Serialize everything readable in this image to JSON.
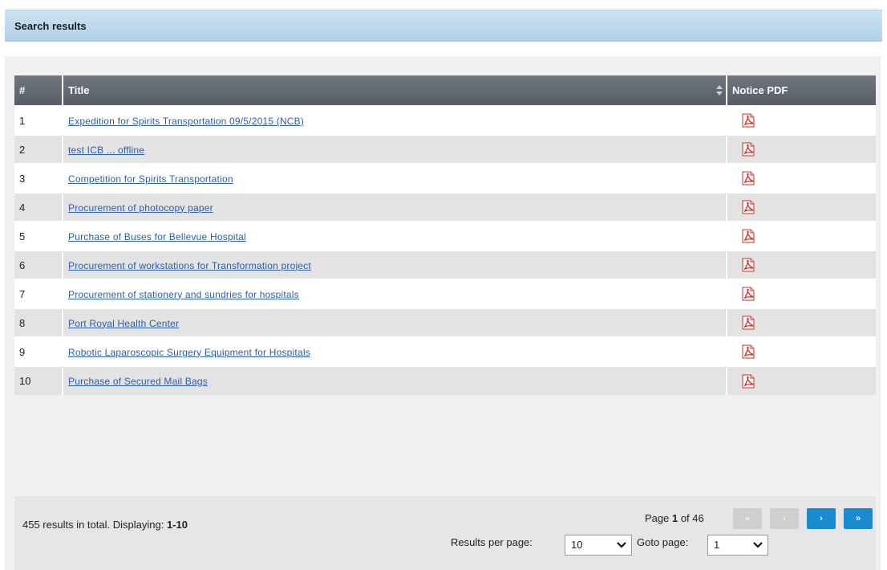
{
  "header": {
    "title": "Search results"
  },
  "table": {
    "columns": {
      "num": "#",
      "title": "Title",
      "pdf": "Notice PDF"
    },
    "rows": [
      {
        "num": "1",
        "title": "Expedition for Spirits Transportation 09/5/2015 (NCB)"
      },
      {
        "num": "2",
        "title": "test ICB ... offline"
      },
      {
        "num": "3",
        "title": "Competition for Spirits Transportation"
      },
      {
        "num": "4",
        "title": "Procurement of photocopy paper"
      },
      {
        "num": "5",
        "title": "Purchase of Buses for Bellevue Hospital"
      },
      {
        "num": "6",
        "title": "Procurement of workstations for Transformation project"
      },
      {
        "num": "7",
        "title": "Procurement of stationery and sundries for hospitals"
      },
      {
        "num": "8",
        "title": "Port Royal Health Center"
      },
      {
        "num": "9",
        "title": "Robotic Laparoscopic Surgery Equipment for Hospitals"
      },
      {
        "num": "10",
        "title": "Purchase of Secured Mail Bags"
      }
    ],
    "pdf_icon": "pdf-file-icon"
  },
  "footer": {
    "total_prefix": "455 results in total. Displaying: ",
    "total_range": "1-10",
    "page_prefix": "Page ",
    "page_current": "1",
    "page_suffix": " of 46",
    "buttons": {
      "first": "«",
      "prev": "‹",
      "next": "›",
      "last": "»"
    },
    "results_per_page_label": "Results per page:",
    "results_per_page_value": "10",
    "goto_label": "Goto page:",
    "goto_value": "1"
  },
  "colors": {
    "header_bg": "#aecfe6",
    "table_header_bg": "#5f666f",
    "row_alt_bg": "#e3e3e3",
    "link": "#2a5db0",
    "pager_active": "#1b8bd0",
    "pager_disabled": "#cfcfcf",
    "pdf_red": "#d42a1e"
  }
}
